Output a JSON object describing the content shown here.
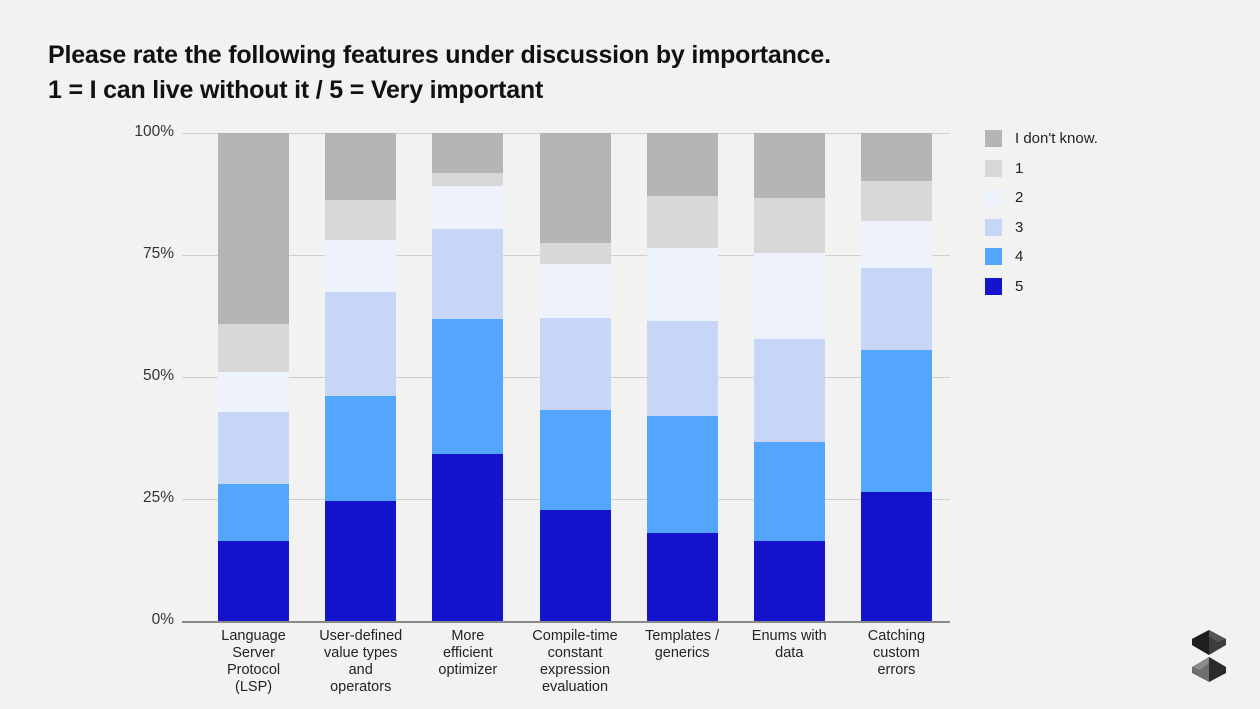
{
  "title": {
    "line1": "Please rate the following features under discussion by importance.",
    "line2": "1 = I can live without it / 5 = Very important"
  },
  "logo": {
    "name": "swift-faceted-s-logo"
  },
  "colors": {
    "background": "#f2f2f0",
    "plot_background": "#f2f2f0",
    "gridline": "#cfcfcf",
    "axis": "#8a8a8a",
    "idk": "#b5b5b5",
    "rating_1": "#d8d8d8",
    "rating_2": "#eef2fc",
    "rating_3": "#c7d5f7",
    "rating_4": "#54a5fc",
    "rating_5": "#1414cc"
  },
  "legend": {
    "position": "right",
    "items": [
      {
        "label": "I don't know.",
        "color": "#b5b5b5"
      },
      {
        "label": "1",
        "color": "#d8d8d8"
      },
      {
        "label": "2",
        "color": "#eef2fc"
      },
      {
        "label": "3",
        "color": "#c7d5f7"
      },
      {
        "label": "4",
        "color": "#54a5fc"
      },
      {
        "label": "5",
        "color": "#1414cc"
      }
    ]
  },
  "axes": {
    "y_ticks": [
      "100%",
      "75%",
      "50%",
      "25%",
      "0%"
    ],
    "y_tick_values": [
      100,
      75,
      50,
      25,
      0
    ]
  },
  "chart_data": {
    "type": "bar",
    "subtype": "stacked-100-percent",
    "title": "Please rate the following features under discussion by importance. 1 = I can live without it / 5 = Very important",
    "xlabel": "",
    "ylabel": "",
    "ylim": [
      0,
      100
    ],
    "grid": true,
    "legend_position": "right",
    "categories": [
      "Language Server Protocol (LSP)",
      "User-defined value types and operators",
      "More efficient optimizer",
      "Compile-time constant expression evaluation",
      "Templates / generics",
      "Enums with data",
      "Catching custom errors"
    ],
    "category_lines": [
      [
        "Language",
        "Server",
        "Protocol",
        "(LSP)"
      ],
      [
        "User-defined",
        "value types",
        "and",
        "operators"
      ],
      [
        "More",
        "efficient",
        "optimizer"
      ],
      [
        "Compile-time",
        "constant",
        "expression",
        "evaluation"
      ],
      [
        "Templates /",
        "generics"
      ],
      [
        "Enums with",
        "data"
      ],
      [
        "Catching",
        "custom",
        "errors"
      ]
    ],
    "stack_order_bottom_to_top": [
      "5",
      "4",
      "3",
      "2",
      "1",
      "I don't know."
    ],
    "series": [
      {
        "name": "5",
        "color": "#1414cc",
        "values": [
          16.4,
          24.6,
          34.2,
          22.7,
          18.0,
          16.4,
          26.4
        ]
      },
      {
        "name": "4",
        "color": "#54a5fc",
        "values": [
          11.7,
          21.5,
          27.7,
          20.5,
          24.0,
          20.3,
          29.1
        ]
      },
      {
        "name": "3",
        "color": "#c7d5f7",
        "values": [
          14.8,
          21.3,
          18.4,
          18.9,
          19.5,
          21.1,
          16.8
        ]
      },
      {
        "name": "2",
        "color": "#eef2fc",
        "values": [
          8.2,
          10.7,
          8.8,
          11.1,
          15.0,
          17.6,
          9.6
        ]
      },
      {
        "name": "1",
        "color": "#d8d8d8",
        "values": [
          9.8,
          8.2,
          2.7,
          4.3,
          10.7,
          11.3,
          8.2
        ]
      },
      {
        "name": "I don't know.",
        "color": "#b5b5b5",
        "values": [
          39.1,
          13.7,
          8.2,
          22.5,
          12.8,
          13.3,
          9.9
        ]
      }
    ]
  }
}
